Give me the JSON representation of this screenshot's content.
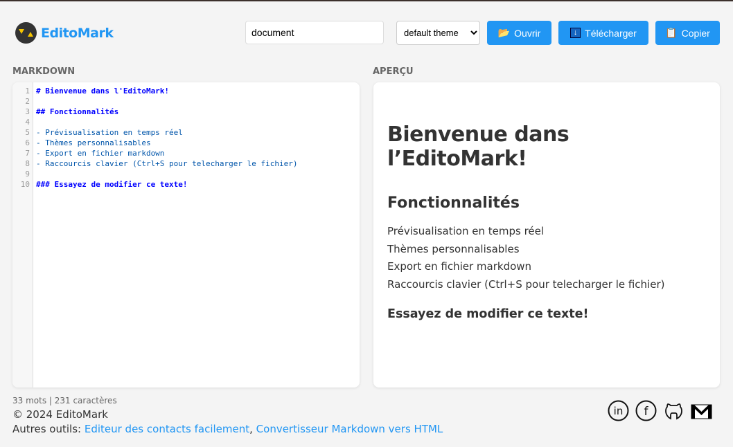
{
  "header": {
    "logo_text": "EditoMark",
    "filename": "document",
    "theme": "default theme",
    "buttons": {
      "open": "Ouvrir",
      "download": "Télécharger",
      "copy": "Copier"
    }
  },
  "labels": {
    "markdown": "MARKDOWN",
    "preview": "APERÇU"
  },
  "editor": {
    "line_numbers": [
      "1",
      "2",
      "3",
      "4",
      "5",
      "6",
      "7",
      "8",
      "9",
      "10"
    ],
    "lines": [
      "# Bienvenue dans l'EditoMark!",
      "",
      "## Fonctionnalités",
      "",
      "- Prévisualisation en temps réel",
      "- Thèmes personnalisables",
      "- Export en fichier markdown",
      "- Raccourcis clavier (Ctrl+S pour telecharger le fichier)",
      "",
      "### Essayez de modifier ce texte!"
    ]
  },
  "preview": {
    "h1": "Bienvenue dans l’EditoMark!",
    "h2": "Fonctionnalités",
    "items": [
      "Prévisualisation en temps réel",
      "Thèmes personnalisables",
      "Export en fichier markdown",
      "Raccourcis clavier (Ctrl+S pour telecharger le fichier)"
    ],
    "h3": "Essayez de modifier ce texte!"
  },
  "footer": {
    "stats": "33 mots | 231 caractères",
    "copyright": "© 2024 EditoMark",
    "tools_label": "Autres outils: ",
    "links": [
      "Editeur des contacts facilement",
      "Convertisseur Markdown vers HTML"
    ],
    "sep": ", "
  },
  "colors": {
    "accent": "#2196f3"
  }
}
